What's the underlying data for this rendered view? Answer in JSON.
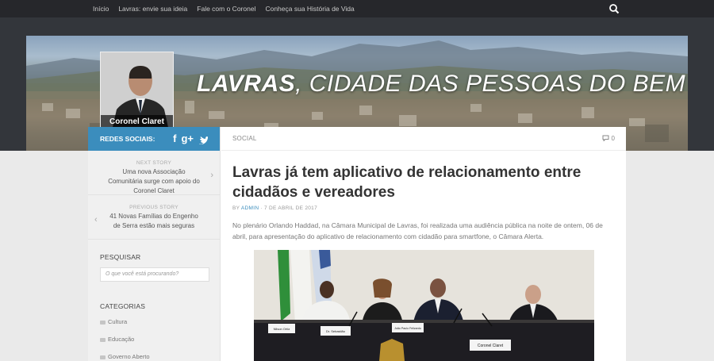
{
  "nav": {
    "items": [
      "Início",
      "Lavras: envie sua ideia",
      "Fale com o Coronel",
      "Conheça sua História de Vida"
    ]
  },
  "header": {
    "title_bold": "LAVRAS",
    "title_rest": ", CIDADE DAS PESSOAS DO BEM",
    "portrait_name": "Coronel Claret"
  },
  "sidebar": {
    "social_label": "REDES SOCIAIS:",
    "social_icons": [
      "facebook-icon",
      "google-plus-icon",
      "twitter-icon"
    ],
    "next_story": {
      "kicker": "NEXT STORY",
      "title": "Uma  nova Associação Comunitária surge com apoio do Coronel Claret"
    },
    "previous_story": {
      "kicker": "PREVIOUS STORY",
      "title": "41 Novas Famílias do Engenho de Serra estão mais seguras"
    },
    "search_title": "PESQUISAR",
    "search_placeholder": "O que você está procurando?",
    "categories_title": "CATEGORIAS",
    "categories": [
      "Cultura",
      "Educação",
      "Governo Aberto"
    ]
  },
  "post": {
    "category": "SOCIAL",
    "comment_count": "0",
    "title": "Lavras já tem aplicativo de relacionamento entre cidadãos e vereadores",
    "meta_by": "BY ",
    "meta_author": "ADMIN",
    "meta_date": " · 7 DE ABRIL DE 2017",
    "excerpt": "No plenário Orlando Haddad, na Câmara Municipal de Lavras, foi realizada uma audiência pública na noite de ontem, 06 de abril, para apresentação do aplicativo de relacionamento com cidadão para smartfone, o Câmara Alerta."
  },
  "photo_nameplates": [
    "Nilson Ortiz",
    "Dr. Sebastião",
    "João Paulo Felizardo",
    "Coronel Claret"
  ],
  "colors": {
    "accent": "#3b8dbd",
    "nav_bg": "#26272b",
    "header_bg": "#33363b"
  }
}
